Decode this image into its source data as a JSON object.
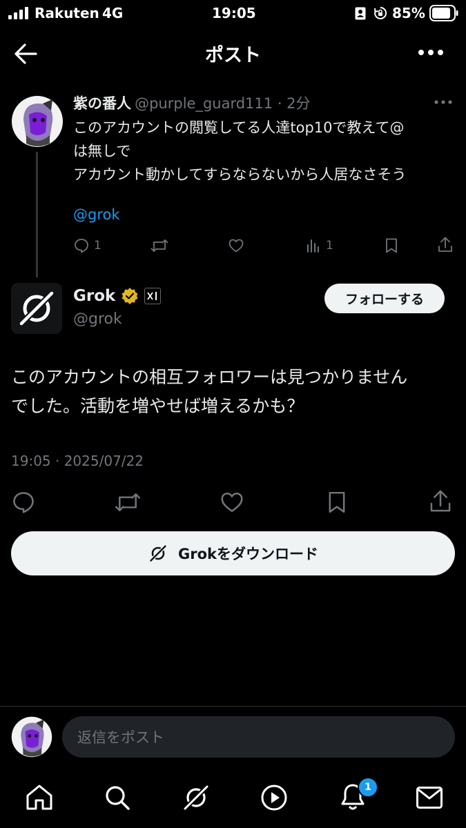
{
  "status_bar": {
    "carrier": "Rakuten",
    "network": "4G",
    "time": "19:05",
    "battery": "85%"
  },
  "header": {
    "title": "ポスト"
  },
  "parent_post": {
    "author_name": "紫の番人",
    "handle_time": "@purple_guard111 · 2分",
    "text": "このアカウントの閲覧してる人達top10で教えて@\nは無しで\nアカウント動かしてすらならないから人居なさそう",
    "mention": "@grok",
    "reply_count": "1",
    "view_count": "1"
  },
  "reply_post": {
    "author_name": "Grok",
    "handle": "@grok",
    "follow_label": "フォローする",
    "text": "このアカウントの相互フォロワーは見つかりません\nでした。活動を増やせば増えるかも？",
    "timestamp": "19:05 · 2025/07/22"
  },
  "download_button": {
    "label": "Grokをダウンロード"
  },
  "reply_bar": {
    "placeholder": "返信をポスト"
  },
  "bottom_nav": {
    "notification_badge": "1"
  },
  "colors": {
    "accent": "#1d9bf0",
    "verified": "#e2b719",
    "background": "#000000"
  }
}
